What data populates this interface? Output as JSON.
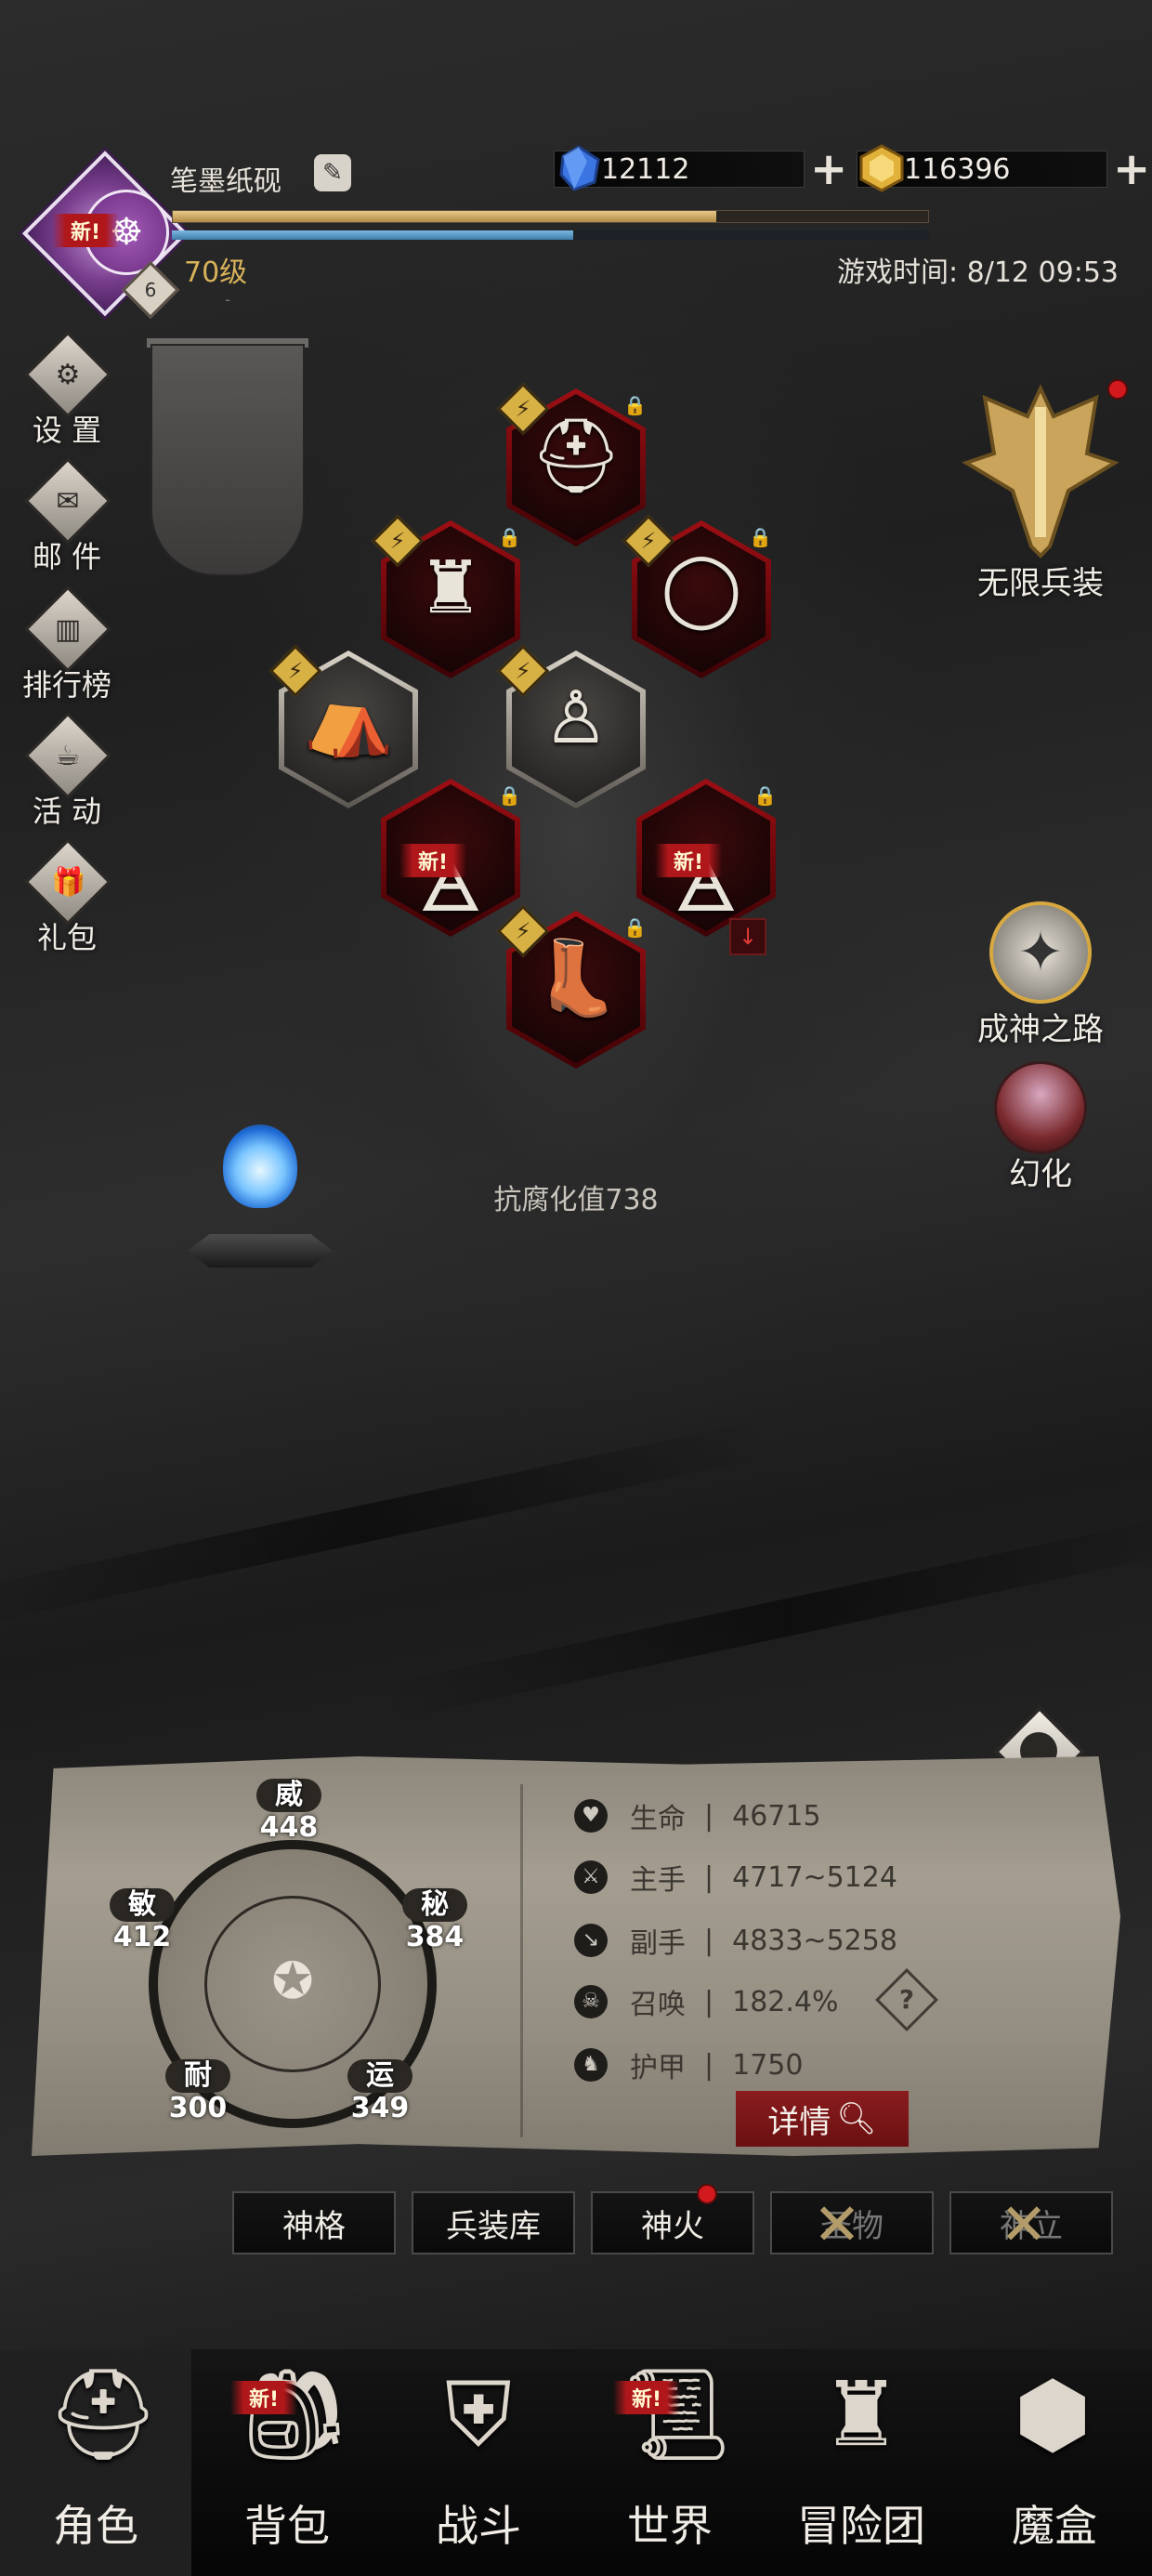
{
  "header": {
    "player_name": "笔墨纸砚",
    "level": "70级",
    "rank_badge": "6",
    "game_time": "游戏时间: 8/12 09:53",
    "xp_progress": 0.72,
    "mp_progress": 0.53,
    "new_label": "新",
    "currencies": [
      {
        "name": "blue-gem",
        "value": "12112",
        "color": "#3f7ee8"
      },
      {
        "name": "gold-coin",
        "value": "116396",
        "color": "#e0b33c"
      }
    ]
  },
  "side_menu": {
    "items": [
      {
        "label": "设 置",
        "icon": "gear-icon"
      },
      {
        "label": "邮 件",
        "icon": "mail-icon"
      },
      {
        "label": "排行榜",
        "icon": "ranking-icon"
      },
      {
        "label": "活 动",
        "icon": "event-icon"
      },
      {
        "label": "礼包",
        "icon": "gift-icon"
      }
    ]
  },
  "right_menu": {
    "infinite_arms": "无限兵装",
    "path_to_god": "成神之路",
    "illusion": "幻化"
  },
  "equipment": {
    "new_label": "新",
    "corrosion_resistance": "抗腐化值738"
  },
  "attributes": {
    "wei": {
      "name": "威",
      "value": "448"
    },
    "mi": {
      "name": "秘",
      "value": "384"
    },
    "min": {
      "name": "敏",
      "value": "412"
    },
    "nai": {
      "name": "耐",
      "value": "300"
    },
    "yun": {
      "name": "运",
      "value": "349"
    }
  },
  "stats": [
    {
      "label": "生命",
      "value": "46715",
      "icon": "heart-icon"
    },
    {
      "label": "主手",
      "value": "4717~5124",
      "icon": "sword-icon"
    },
    {
      "label": "副手",
      "value": "4833~5258",
      "icon": "offhand-icon"
    },
    {
      "label": "召唤",
      "value": "182.4%",
      "icon": "summon-icon"
    },
    {
      "label": "护甲",
      "value": "1750",
      "icon": "armor-icon"
    }
  ],
  "detail_button": "详情",
  "sub_tabs": [
    "神格",
    "兵装库",
    "神火",
    "圣物",
    "神立"
  ],
  "bottom_nav": [
    {
      "label": "角色",
      "icon": "helmet-icon"
    },
    {
      "label": "背包",
      "icon": "backpack-icon"
    },
    {
      "label": "战斗",
      "icon": "shield-sword-icon"
    },
    {
      "label": "世界",
      "icon": "scroll-map-icon"
    },
    {
      "label": "冒险团",
      "icon": "castle-icon"
    },
    {
      "label": "魔盒",
      "icon": "cube-icon"
    }
  ]
}
